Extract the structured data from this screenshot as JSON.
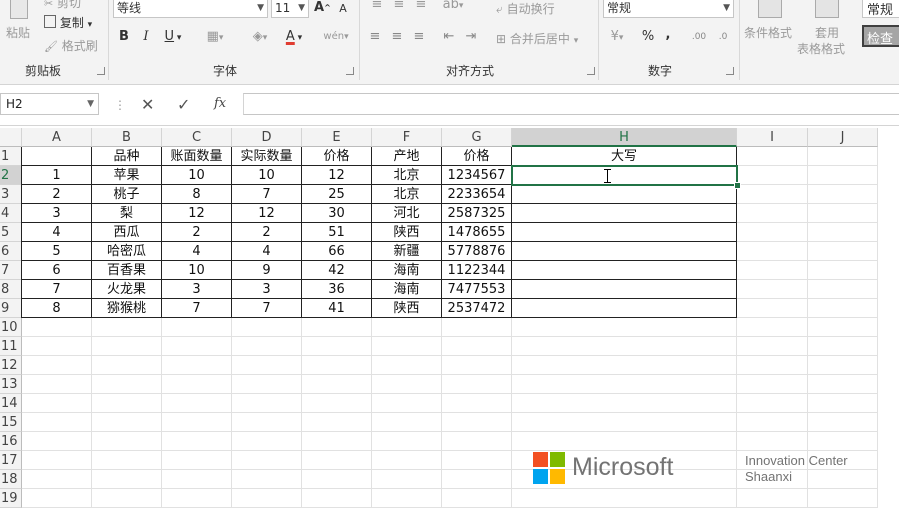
{
  "ribbon": {
    "clipboard": {
      "paste": "粘贴",
      "cut": "剪切",
      "copy": "复制",
      "format_painter": "格式刷",
      "label": "剪贴板"
    },
    "font": {
      "family": "等线",
      "size": "11",
      "bold": "B",
      "italic": "I",
      "underline": "U",
      "label": "字体",
      "phonetic": "wén"
    },
    "alignment": {
      "wrap": "自动换行",
      "merge": "合并后居中",
      "label": "对齐方式"
    },
    "number": {
      "format": "常规",
      "percent": "%",
      "comma": ",",
      "label": "数字"
    },
    "styles": {
      "conditional": "条件格式",
      "table_format_l1": "套用",
      "table_format_l2": "表格格式",
      "cell_style": "常规",
      "check": "检查"
    }
  },
  "formula_bar": {
    "name_box": "H2",
    "cancel": "✕",
    "enter": "✓",
    "fx": "fx",
    "value": ""
  },
  "columns": [
    "A",
    "B",
    "C",
    "D",
    "E",
    "F",
    "G",
    "H",
    "I",
    "J"
  ],
  "rows": [
    "1",
    "2",
    "3",
    "4",
    "5",
    "6",
    "7",
    "8",
    "9",
    "10",
    "11",
    "12",
    "13",
    "14",
    "15",
    "16",
    "17",
    "18",
    "19"
  ],
  "selected_cell": "H2",
  "table": {
    "headers": [
      "",
      "品种",
      "账面数量",
      "实际数量",
      "价格",
      "产地",
      "价格",
      "大写"
    ],
    "data": [
      [
        "1",
        "苹果",
        "10",
        "10",
        "12",
        "北京",
        "1234567",
        ""
      ],
      [
        "2",
        "桃子",
        "8",
        "7",
        "25",
        "北京",
        "2233654",
        ""
      ],
      [
        "3",
        "梨",
        "12",
        "12",
        "30",
        "河北",
        "2587325",
        ""
      ],
      [
        "4",
        "西瓜",
        "2",
        "2",
        "51",
        "陕西",
        "1478655",
        ""
      ],
      [
        "5",
        "哈密瓜",
        "4",
        "4",
        "66",
        "新疆",
        "5778876",
        ""
      ],
      [
        "6",
        "百香果",
        "10",
        "9",
        "42",
        "海南",
        "1122344",
        ""
      ],
      [
        "7",
        "火龙果",
        "3",
        "3",
        "36",
        "海南",
        "7477553",
        ""
      ],
      [
        "8",
        "猕猴桃",
        "7",
        "7",
        "41",
        "陕西",
        "2537472",
        ""
      ]
    ]
  },
  "watermark": {
    "brand": "Microsoft",
    "line1": "Innovation Center",
    "line2": "Shaanxi",
    "colors": [
      "#f25022",
      "#7fba00",
      "#00a4ef",
      "#ffb900"
    ]
  }
}
